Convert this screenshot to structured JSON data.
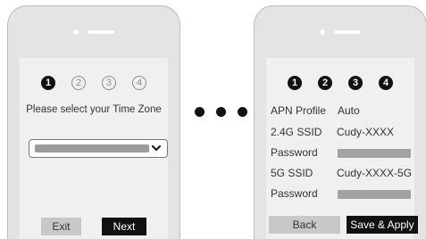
{
  "left_phone": {
    "steps": [
      "1",
      "2",
      "3",
      "4"
    ],
    "prompt": "Please select your Time Zone",
    "buttons": {
      "exit": "Exit",
      "next": "Next"
    }
  },
  "right_phone": {
    "steps": [
      "1",
      "2",
      "3",
      "4"
    ],
    "fields": {
      "apn_profile": {
        "label": "APN Profile",
        "value": "Auto"
      },
      "ssid_24": {
        "label": "2.4G SSID",
        "value": "Cudy-XXXX"
      },
      "password_24": {
        "label": "Password"
      },
      "ssid_5": {
        "label": "5G SSID",
        "value": "Cudy-XXXX-5G"
      },
      "password_5": {
        "label": "Password"
      }
    },
    "buttons": {
      "back": "Back",
      "save_apply": "Save & Apply"
    }
  },
  "icons": {
    "dropdown": "chevron-down-icon",
    "ellipsis": "ellipsis-dots"
  },
  "colors": {
    "screen": "#f0f0f0",
    "phone": "#e4e4e4",
    "primary_button": "#111111",
    "secondary_button": "#c8c8c8"
  }
}
